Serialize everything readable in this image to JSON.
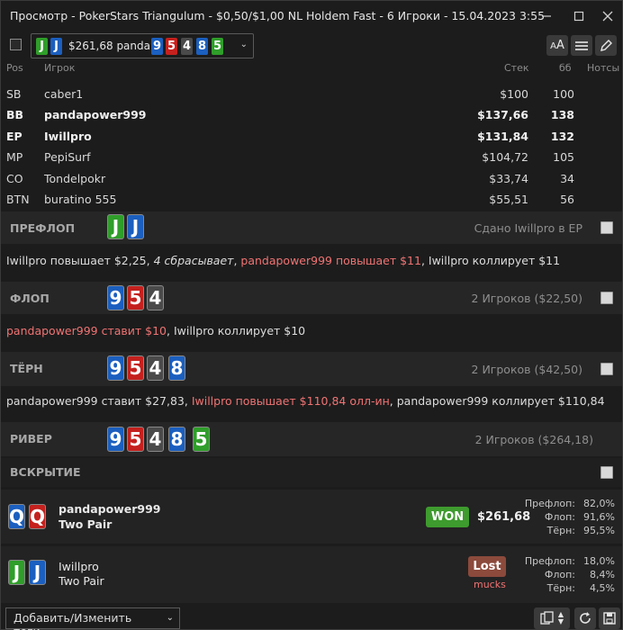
{
  "window": {
    "title": "Просмотр - PokerStars Triangulum - $0,50/$1,00 NL Holdem Fast - 6 Игроки - 15.04.2023 3:55"
  },
  "toolbar": {
    "combo_hole": [
      "J",
      "J"
    ],
    "combo_amount": "$261,68 panda",
    "combo_board": [
      "9",
      "5",
      "4",
      "8",
      "5"
    ]
  },
  "table_header": {
    "pos": "Pos",
    "player": "Игрок",
    "stack": "Стек",
    "bb": "бб",
    "notes": "Нотсы"
  },
  "players": [
    {
      "pos": "SB",
      "name": "caber1",
      "stack": "$100",
      "bb": "100",
      "bold": false
    },
    {
      "pos": "BB",
      "name": "pandapower999",
      "stack": "$137,66",
      "bb": "138",
      "bold": true
    },
    {
      "pos": "EP",
      "name": "Iwillpro",
      "stack": "$131,84",
      "bb": "132",
      "bold": true
    },
    {
      "pos": "MP",
      "name": "PepiSurf",
      "stack": "$104,72",
      "bb": "105",
      "bold": false
    },
    {
      "pos": "CO",
      "name": "Tondelpokr",
      "stack": "$33,74",
      "bb": "34",
      "bold": false
    },
    {
      "pos": "BTN",
      "name": "buratino 555",
      "stack": "$55,51",
      "bb": "56",
      "bold": false
    }
  ],
  "streets": {
    "preflop": {
      "label": "ПРЕФЛОП",
      "info": "Сдано Iwillpro в EP",
      "cards": [
        "J",
        "J"
      ]
    },
    "flop": {
      "label": "ФЛОП",
      "info": "2 Игроков ($22,50)",
      "cards": [
        "9",
        "5",
        "4"
      ]
    },
    "turn": {
      "label": "ТЁРН",
      "info": "2 Игроков ($42,50)",
      "cards": [
        "9",
        "5",
        "4",
        "8"
      ]
    },
    "river": {
      "label": "РИВЕР",
      "info": "2 Игроков ($264,18)",
      "cards": [
        "9",
        "5",
        "4",
        "8",
        "5"
      ]
    },
    "showdown": {
      "label": "ВСКРЫТИЕ"
    }
  },
  "actions": {
    "preflop": {
      "a1": "Iwillpro повышает $2,25, ",
      "a2": "4 сбрасывает",
      "a3": ", ",
      "a4": "pandapower999 повышает $11",
      "a5": ", Iwillpro коллирует $11"
    },
    "flop": {
      "a1": "pandapower999 ставит $10",
      "a2": ", Iwillpro коллирует $10"
    },
    "turn": {
      "a1": "pandapower999 ставит $27,83, ",
      "a2": "Iwillpro повышает $110,84 олл-ин",
      "a3": ", pandapower999 коллирует $110,84"
    }
  },
  "showdown": [
    {
      "cards": [
        "Q",
        "Q"
      ],
      "name": "pandapower999",
      "hand": "Two Pair",
      "result": "WON",
      "amount": "$261,68",
      "eq_labels": [
        "Префлоп:",
        "Флоп:",
        "Тёрн:"
      ],
      "eq_values": [
        "82,0%",
        "91,6%",
        "95,5%"
      ]
    },
    {
      "cards": [
        "J",
        "J"
      ],
      "name": "Iwillpro",
      "hand": "Two Pair",
      "result": "Lost",
      "sub": "mucks",
      "eq_labels": [
        "Префлоп:",
        "Флоп:",
        "Тёрн:"
      ],
      "eq_values": [
        "18,0%",
        "8,4%",
        "4,5%"
      ]
    }
  ],
  "footer": {
    "tags_label": "Добавить/Изменить теги..."
  },
  "colors": {
    "club": "#2f9e2a",
    "spade_or_diamond_blue": "#1b5fbf",
    "heart": "#c4211e",
    "gray_card": "#4a4a4a",
    "won_badge": "#3e9b2e",
    "lost_badge": "#8b4a3c",
    "action_highlight": "#f07373"
  }
}
